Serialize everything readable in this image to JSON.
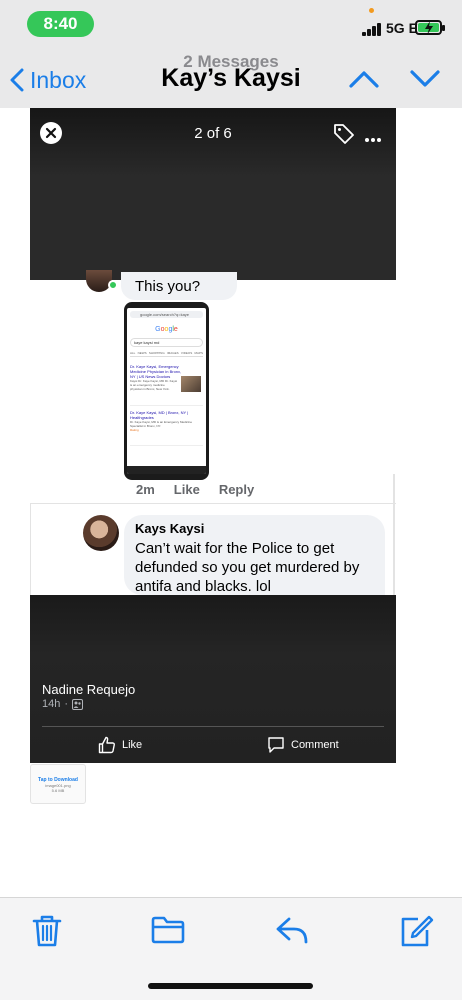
{
  "status_bar": {
    "time": "8:40",
    "network": "5G E"
  },
  "nav": {
    "back_label": "Inbox",
    "subtitle": "2 Messages",
    "title": "Kay’s Kaysi",
    "up_icon": "chevron-up-icon",
    "down_icon": "chevron-down-icon"
  },
  "viewer": {
    "counter": "2 of 6"
  },
  "comment_top": {
    "text": "This you?"
  },
  "screenshot": {
    "url": "google.com/search?q=kaye",
    "search_query": "kaye kaysi md",
    "tabs": [
      "ALL",
      "NEWS",
      "SHOPPING",
      "IMAGES",
      "VIDEOS",
      "MAPS"
    ],
    "result1_title": "Dr. Kaye Kaysi, Emergency Medicine Physician in Bronx, NY | US News Doctors",
    "result1_text": "Kaysi Dr. Kaye Kaysi, MD Dr. Kaysi is an emergency medicine physician in Bronx, New York.",
    "result2_title": "Dr. Kaye Kaysi, MD | Bronx, NY | Healthgrades",
    "result2_text": "Dr. Kaye Kaysi, MD is an Emergency Medicine Specialist in Bronx, NY.",
    "rating": "Rating"
  },
  "comment_meta": {
    "time": "2m",
    "like": "Like",
    "reply": "Reply"
  },
  "reply_comment": {
    "author": "Kays Kaysi",
    "text": "Can’t wait for the Police to get defunded so you get murdered by antifa and blacks.  lol"
  },
  "post": {
    "author": "Nadine Requejo",
    "time": "14h",
    "like_label": "Like",
    "comment_label": "Comment"
  },
  "attachment": {
    "label": "Tap to Download",
    "filename": "image001.png",
    "size": "5.6 MB"
  },
  "toolbar": {
    "icons": [
      "trash-icon",
      "folder-icon",
      "reply-icon",
      "compose-icon"
    ]
  },
  "colors": {
    "accent": "#1b7ee8",
    "status_green": "#35c759",
    "topbar_bg": "#e9e9ea"
  }
}
